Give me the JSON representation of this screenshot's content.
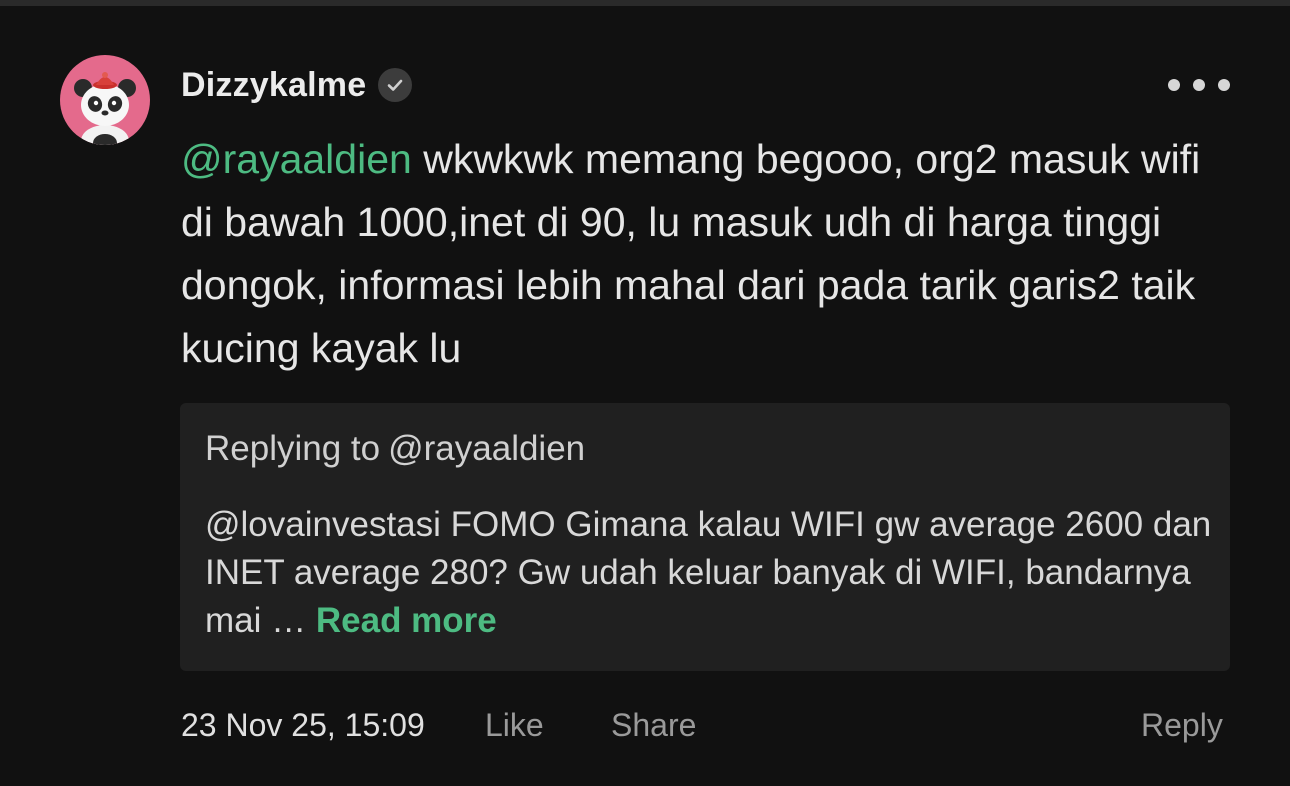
{
  "post": {
    "username": "Dizzykalme",
    "verified_icon": "verified-check-icon",
    "more_icon": "more-horizontal-icon",
    "mention": "@rayaaldien",
    "body": " wkwkwk memang begooo, org2 masuk wifi di bawah 1000,inet di 90, lu masuk udh di harga tinggi dongok, informasi lebih mahal dari pada tarik garis2 taik kucing kayak lu"
  },
  "reply_context": {
    "label": "Replying to",
    "handle": "@rayaaldien",
    "quoted_text": "@lovainvestasi FOMO Gimana kalau WIFI gw average 2600 dan INET average 280? Gw udah keluar banyak di WIFI, bandarnya mai … ",
    "read_more_label": "Read more"
  },
  "footer": {
    "timestamp": "23 Nov 25, 15:09",
    "like_label": "Like",
    "share_label": "Share",
    "reply_label": "Reply"
  },
  "colors": {
    "background": "#111111",
    "accent_green": "#4dbb82",
    "quote_background": "#202020",
    "avatar_background": "#e46a8c"
  }
}
